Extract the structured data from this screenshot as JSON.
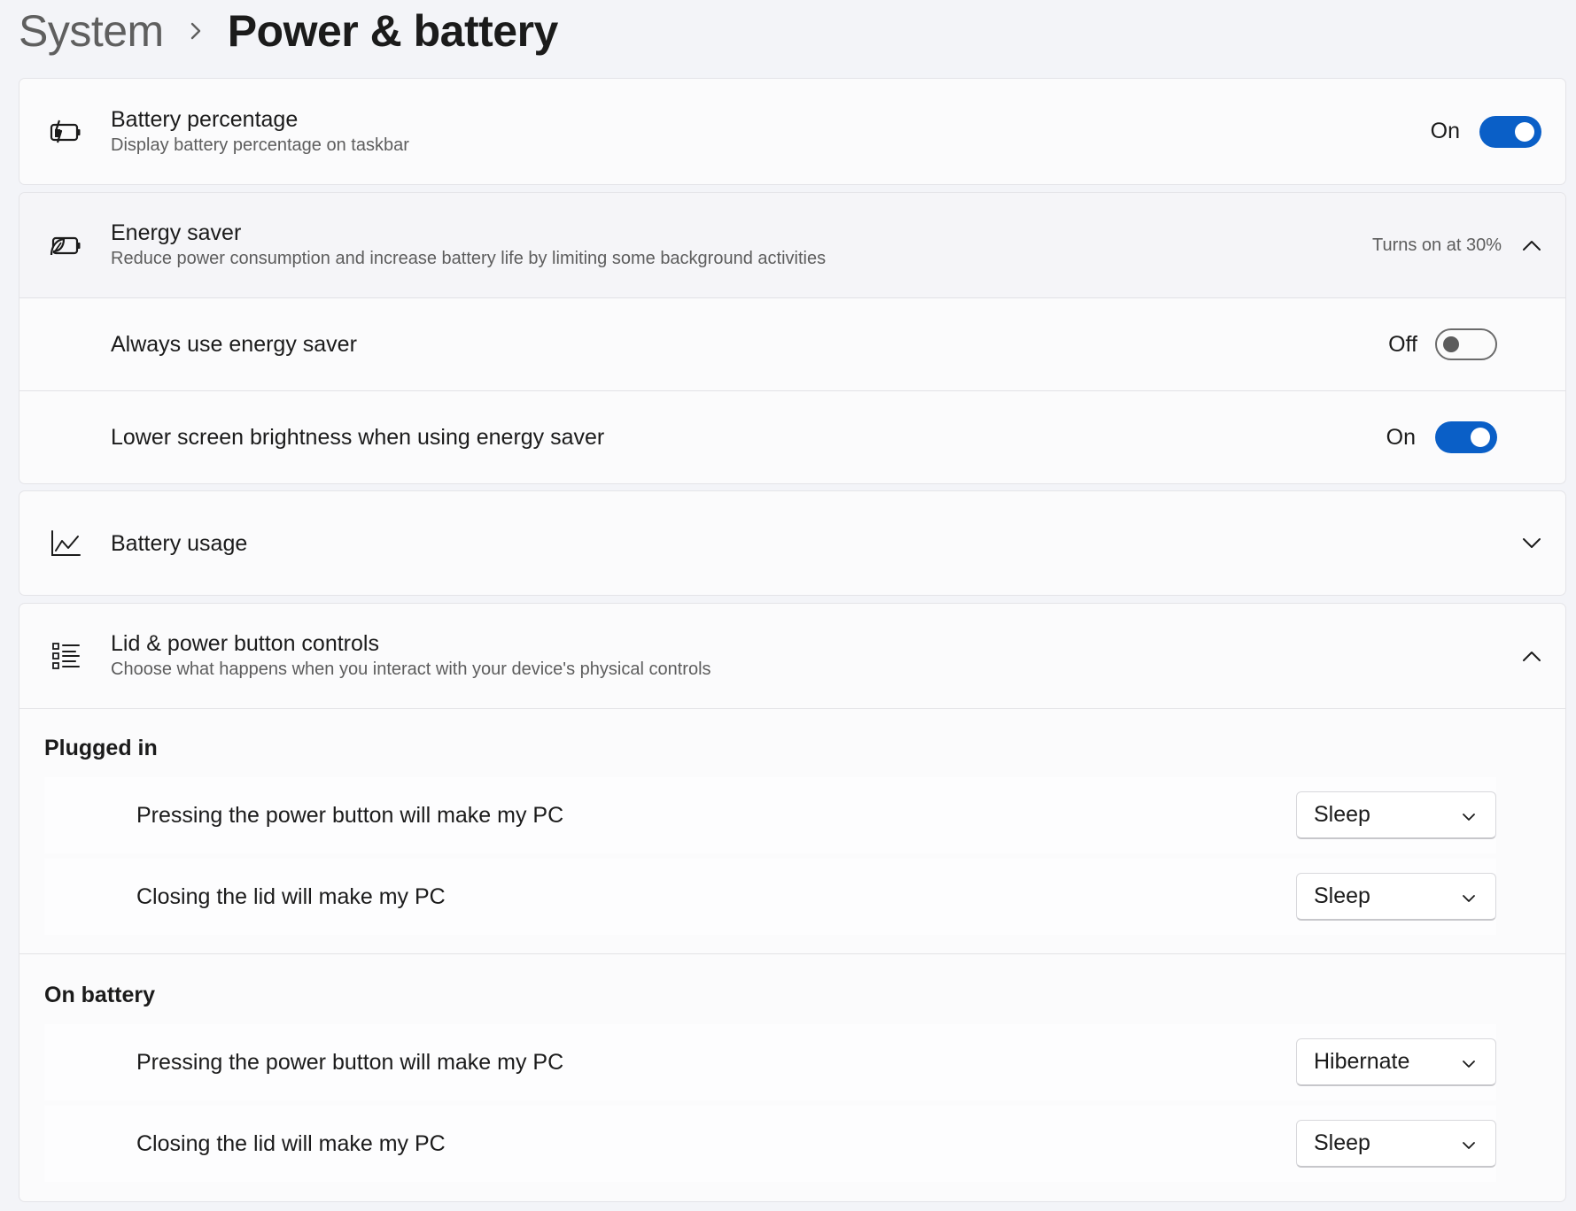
{
  "breadcrumb": {
    "parent": "System",
    "current": "Power & battery"
  },
  "battery_percentage": {
    "title": "Battery percentage",
    "subtitle": "Display battery percentage on taskbar",
    "state_label": "On",
    "toggle_on": true
  },
  "energy_saver": {
    "title": "Energy saver",
    "subtitle": "Reduce power consumption and increase battery life by limiting some background activities",
    "status": "Turns on at 30%",
    "expanded": true,
    "always_use": {
      "label": "Always use energy saver",
      "state_label": "Off",
      "toggle_on": false
    },
    "lower_brightness": {
      "label": "Lower screen brightness when using energy saver",
      "state_label": "On",
      "toggle_on": true
    }
  },
  "battery_usage": {
    "title": "Battery usage",
    "expanded": false
  },
  "lid_power": {
    "title": "Lid & power button controls",
    "subtitle": "Choose what happens when you interact with your device's physical controls",
    "expanded": true,
    "plugged_in": {
      "label": "Plugged in",
      "power_button": {
        "label": "Pressing the power button will make my PC",
        "value": "Sleep"
      },
      "lid": {
        "label": "Closing the lid will make my PC",
        "value": "Sleep"
      }
    },
    "on_battery": {
      "label": "On battery",
      "power_button": {
        "label": "Pressing the power button will make my PC",
        "value": "Hibernate"
      },
      "lid": {
        "label": "Closing the lid will make my PC",
        "value": "Sleep"
      }
    }
  },
  "colors": {
    "accent": "#0a5fc7",
    "background": "#f3f4f8",
    "card": "#fbfbfc"
  },
  "icons": {
    "battery_percentage": "battery-charging-icon",
    "energy_saver": "battery-leaf-icon",
    "battery_usage": "line-chart-icon",
    "lid_power": "list-icon"
  }
}
